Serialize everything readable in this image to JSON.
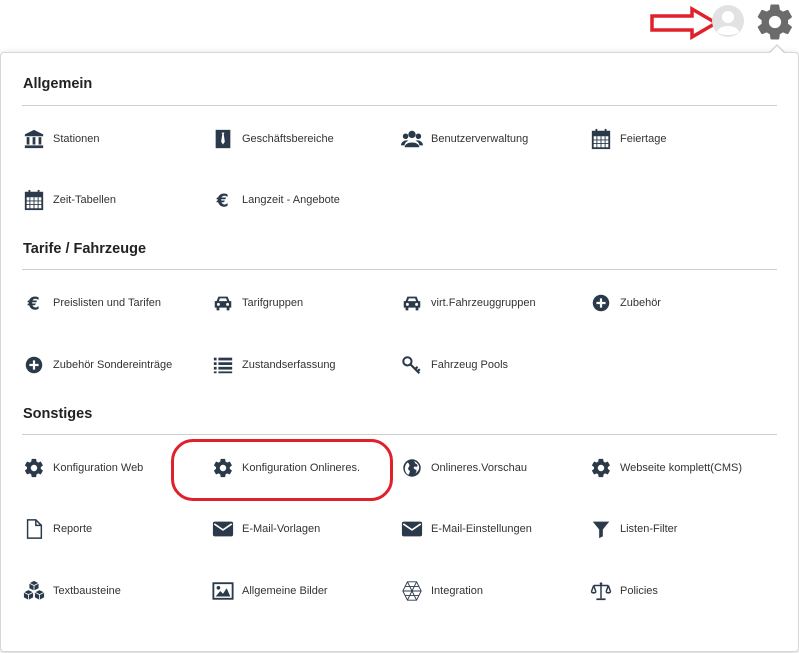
{
  "header": {
    "arrow_icon": "red-arrow-annotation",
    "user_icon": "user-circle-icon",
    "settings_icon": "gear-icon"
  },
  "sections": [
    {
      "title": "Allgemein",
      "items": [
        {
          "label": "Stationen",
          "icon": "bank-icon"
        },
        {
          "label": "Geschäftsbereiche",
          "icon": "suit-tie-icon"
        },
        {
          "label": "Benutzerverwaltung",
          "icon": "users-icon"
        },
        {
          "label": "Feiertage",
          "icon": "calendar-icon"
        },
        {
          "label": "Zeit-Tabellen",
          "icon": "calendar-icon"
        },
        {
          "label": "Langzeit - Angebote",
          "icon": "euro-icon"
        }
      ]
    },
    {
      "title": "Tarife / Fahrzeuge",
      "items": [
        {
          "label": "Preislisten und Tarifen",
          "icon": "euro-icon"
        },
        {
          "label": "Tarifgruppen",
          "icon": "car-icon"
        },
        {
          "label": "virt.Fahrzeuggruppen",
          "icon": "car-icon"
        },
        {
          "label": "Zubehör",
          "icon": "plus-circle-icon"
        },
        {
          "label": "Zubehör Sondereinträge",
          "icon": "plus-circle-icon"
        },
        {
          "label": "Zustandserfassung",
          "icon": "list-icon"
        },
        {
          "label": "Fahrzeug Pools",
          "icon": "key-icon"
        }
      ]
    },
    {
      "title": "Sonstiges",
      "items": [
        {
          "label": "Konfiguration Web",
          "icon": "gear-icon"
        },
        {
          "label": "Konfiguration Onlineres.",
          "icon": "gear-icon"
        },
        {
          "label": "Onlineres.Vorschau",
          "icon": "globe-icon"
        },
        {
          "label": "Webseite komplett(CMS)",
          "icon": "gear-icon"
        },
        {
          "label": "Reporte",
          "icon": "file-icon"
        },
        {
          "label": "E-Mail-Vorlagen",
          "icon": "envelope-icon"
        },
        {
          "label": "E-Mail-Einstellungen",
          "icon": "envelope-icon"
        },
        {
          "label": "Listen-Filter",
          "icon": "filter-icon"
        },
        {
          "label": "Textbausteine",
          "icon": "cubes-icon"
        },
        {
          "label": "Allgemeine Bilder",
          "icon": "image-icon"
        },
        {
          "label": "Integration",
          "icon": "connectdevelop-icon"
        },
        {
          "label": "Policies",
          "icon": "balance-scale-icon"
        }
      ]
    }
  ],
  "annotations": {
    "highlight_color": "#e0202a",
    "highlighted_item": "Konfiguration Onlineres."
  }
}
